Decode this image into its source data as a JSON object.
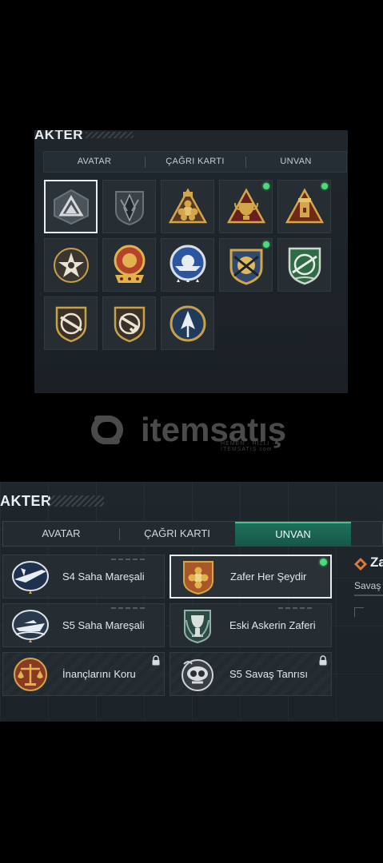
{
  "top_panel": {
    "title": "AKTER",
    "tabs": [
      {
        "label": "AVATAR"
      },
      {
        "label": "ÇAĞRI KARTI"
      },
      {
        "label": "UNVAN"
      }
    ],
    "emblems": [
      {
        "icon": "triangle-mountain-emblem-icon",
        "selected": true,
        "new": false
      },
      {
        "icon": "arrowhead-shield-emblem-icon",
        "selected": false,
        "new": false
      },
      {
        "icon": "gold-flower-triangle-emblem-icon",
        "selected": false,
        "new": false
      },
      {
        "icon": "trophy-triangle-emblem-icon",
        "selected": false,
        "new": true
      },
      {
        "icon": "tower-triangle-emblem-icon",
        "selected": false,
        "new": true
      },
      {
        "icon": "star-circle-emblem-icon",
        "selected": false,
        "new": false
      },
      {
        "icon": "medal-stars-emblem-icon",
        "selected": false,
        "new": false
      },
      {
        "icon": "sun-ship-stars-emblem-icon",
        "selected": false,
        "new": false
      },
      {
        "icon": "crossed-weapons-shield-emblem-icon",
        "selected": false,
        "new": true
      },
      {
        "icon": "green-rifle-shield-emblem-icon",
        "selected": false,
        "new": false
      },
      {
        "icon": "rifle-shield-emblem-icon",
        "selected": false,
        "new": false
      },
      {
        "icon": "pistol-shield-emblem-icon",
        "selected": false,
        "new": false
      },
      {
        "icon": "blue-arrow-circle-emblem-icon",
        "selected": false,
        "new": false
      }
    ]
  },
  "watermark": {
    "text": "itemsatış",
    "subtext": "HEMEN · HIZLI · İTEMSATIŞ.com"
  },
  "bottom_panel": {
    "title": "AKTER",
    "tabs": [
      {
        "label": "AVATAR",
        "active": false
      },
      {
        "label": "ÇAĞRI KARTI",
        "active": false
      },
      {
        "label": "UNVAN",
        "active": true
      }
    ],
    "titles": [
      {
        "label": "S4 Saha Mareşali",
        "icon": "jet-plane-emblem-icon",
        "selected": false,
        "new": false,
        "locked": false
      },
      {
        "label": "Zafer Her Şeydir",
        "icon": "gold-medal-emblem-icon",
        "selected": true,
        "new": true,
        "locked": false
      },
      {
        "label": "S5 Saha Mareşali",
        "icon": "speedboat-emblem-icon",
        "selected": false,
        "new": false,
        "locked": false
      },
      {
        "label": "Eski Askerin Zaferi",
        "icon": "trophy-wreath-emblem-icon",
        "selected": false,
        "new": false,
        "locked": false
      },
      {
        "label": "İnançlarını Koru",
        "icon": "scales-emblem-icon",
        "selected": false,
        "new": false,
        "locked": true
      },
      {
        "label": "S5 Savaş Tanrısı",
        "icon": "diver-skull-emblem-icon",
        "selected": false,
        "new": false,
        "locked": true
      }
    ],
    "side_info": {
      "heading": "Za",
      "subheading": "Savaş",
      "icon": "diamond-emblem-icon"
    }
  },
  "colors": {
    "accent_green": "#46c58c",
    "new_dot": "#4bdc77",
    "gold": "#c9a04a"
  }
}
